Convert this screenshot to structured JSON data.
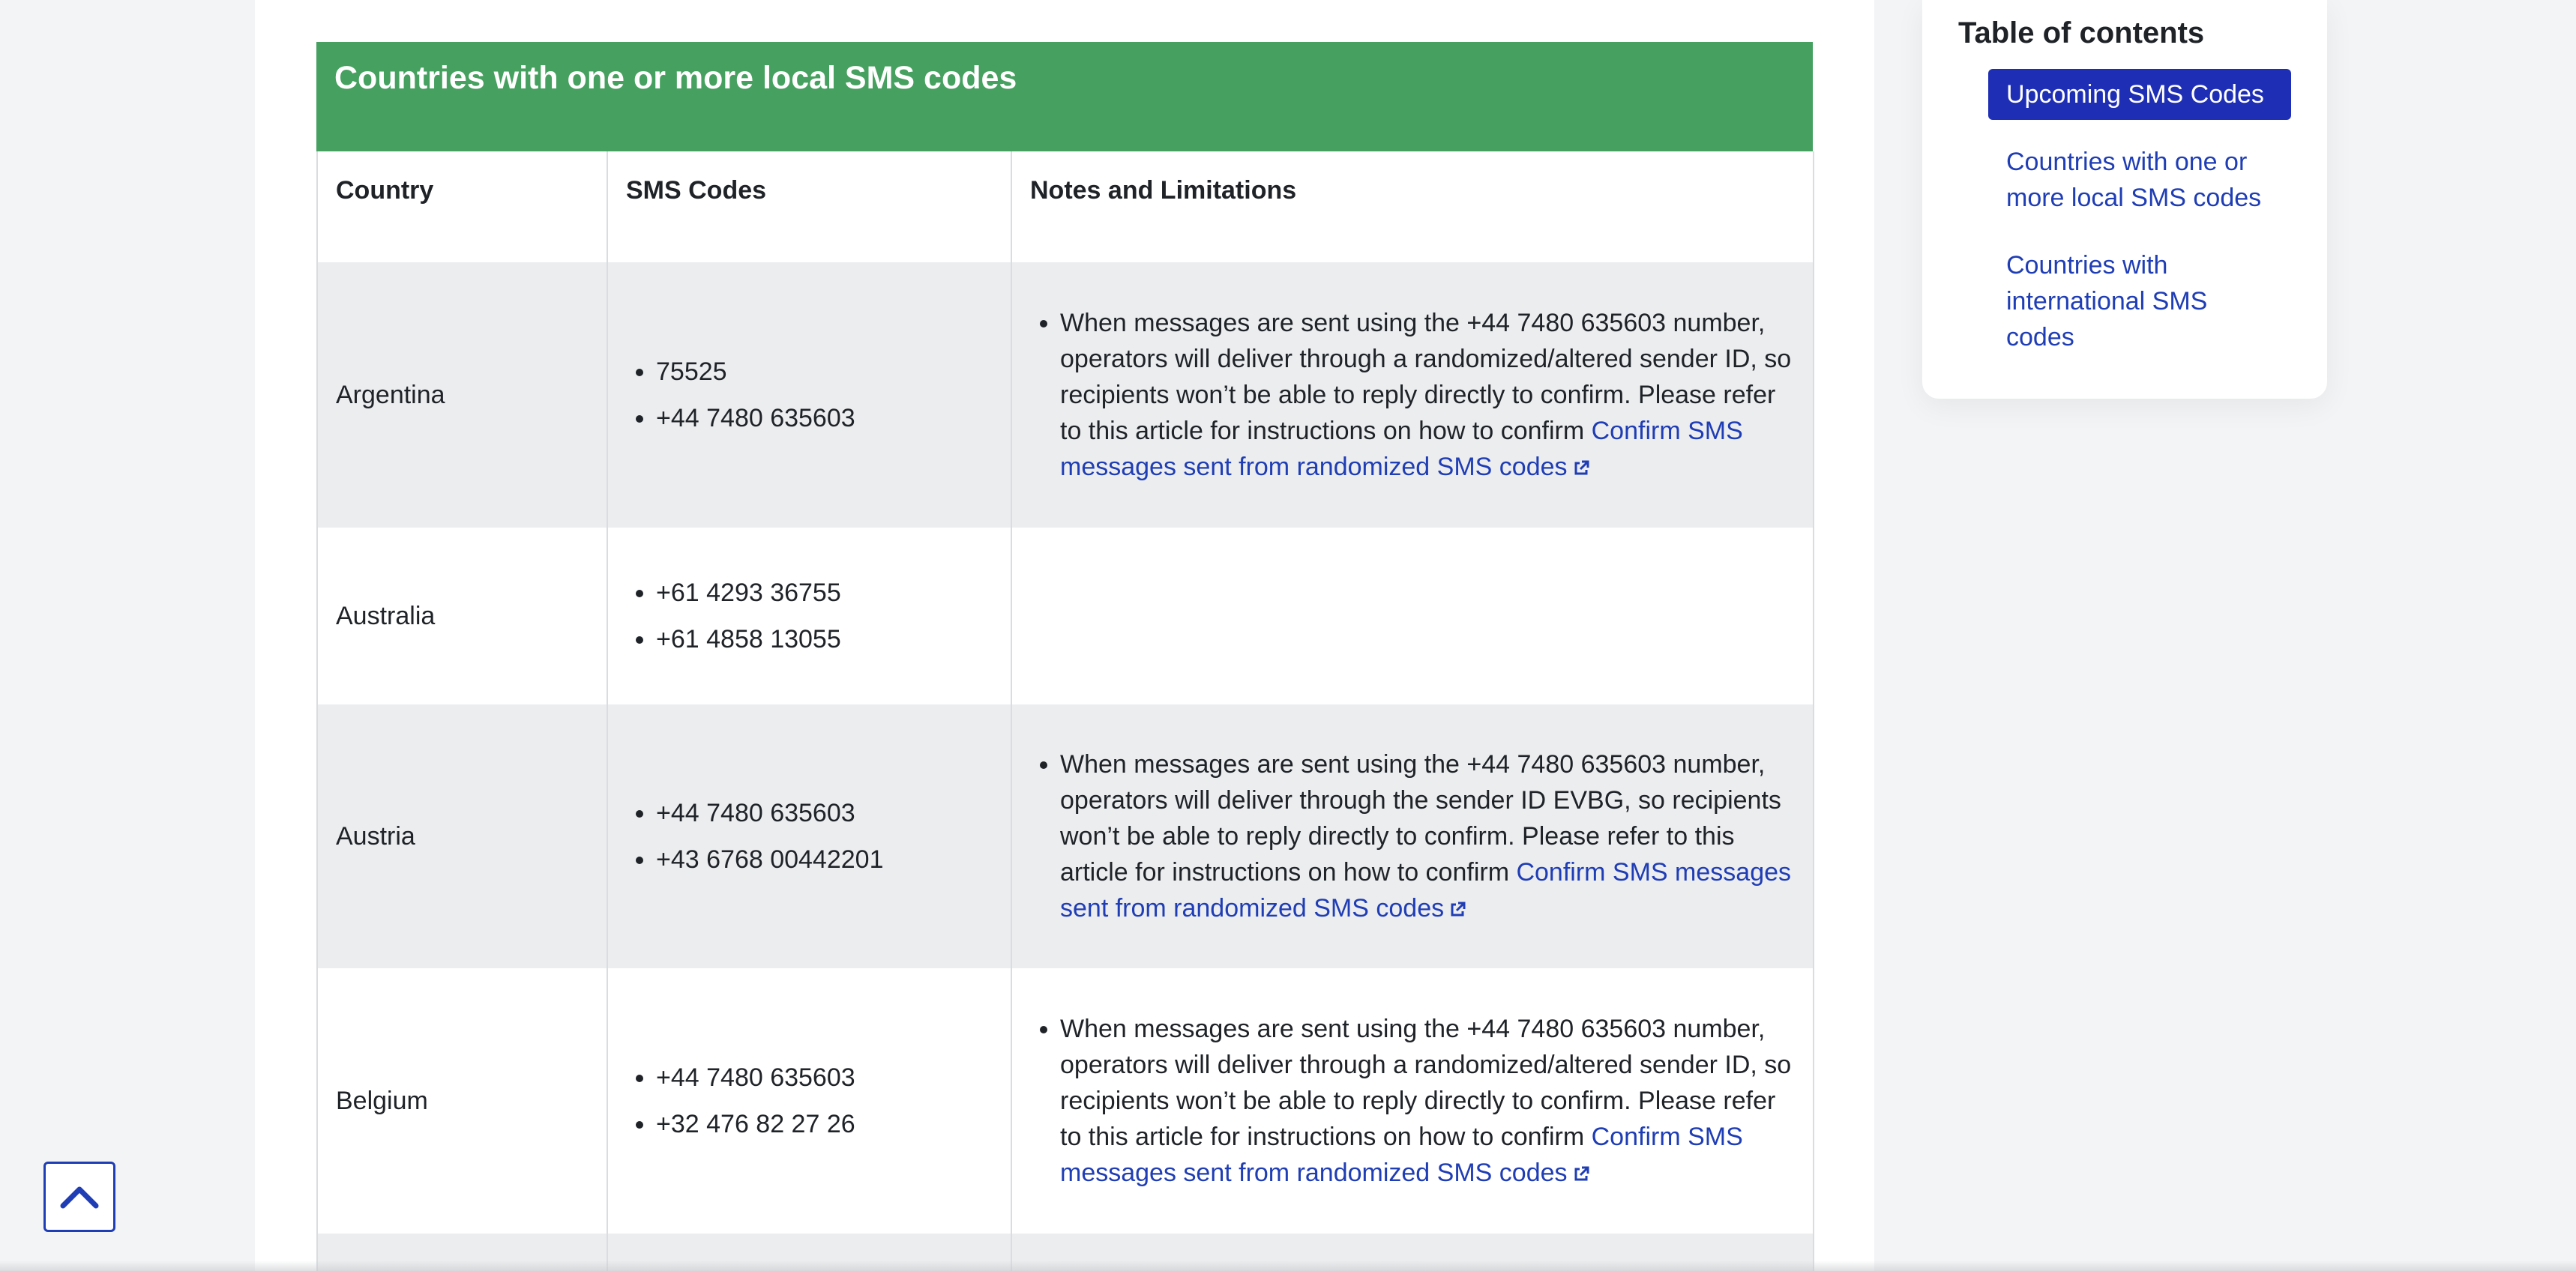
{
  "table": {
    "title": "Countries with one or more local SMS codes",
    "headers": {
      "country": "Country",
      "codes": "SMS Codes",
      "notes": "Notes and Limitations"
    },
    "rows": [
      {
        "country": "Argentina",
        "codes": [
          "75525",
          "+44 7480 635603"
        ],
        "note_text": "When messages are sent using the +44 7480 635603 number, operators will deliver through a randomized/altered sender ID, so recipients won’t be able to reply directly to confirm. Please refer to this article for instructions on how to confirm ",
        "note_link": "Confirm SMS messages sent from randomized SMS codes"
      },
      {
        "country": "Australia",
        "codes": [
          "+61 4293 36755",
          "+61 4858 13055"
        ],
        "note_text": "",
        "note_link": ""
      },
      {
        "country": "Austria",
        "codes": [
          "+44 7480 635603",
          "+43 6768 00442201"
        ],
        "note_text": "When messages are sent using the +44 7480 635603 number, operators will deliver through the sender ID EVBG, so recipients won’t be able to reply directly to confirm. Please refer to this article for instructions on how to confirm ",
        "note_link": "Confirm SMS messages sent from randomized SMS codes"
      },
      {
        "country": "Belgium",
        "codes": [
          "+44 7480 635603",
          "+32 476 82 27 26"
        ],
        "note_text": "When messages are sent using the +44 7480 635603 number, operators will deliver through a randomized/altered sender ID, so recipients won’t be able to reply directly to confirm. Please refer to this article for instructions on how to confirm ",
        "note_link": "Confirm SMS messages sent from randomized SMS codes"
      }
    ]
  },
  "toc": {
    "title": "Table of contents",
    "items": [
      {
        "label": "Upcoming SMS Codes",
        "active": true
      },
      {
        "label": "Countries with one or more local SMS codes",
        "active": false
      },
      {
        "label": "Countries with international SMS codes",
        "active": false
      }
    ]
  },
  "icons": {
    "external_link": "external-link-icon",
    "back_to_top": "chevron-up-icon"
  },
  "colors": {
    "banner_green": "#46a05f",
    "link_blue": "#1f3db5",
    "active_toc": "#1f2fb5",
    "row_shade": "#ecedef"
  }
}
